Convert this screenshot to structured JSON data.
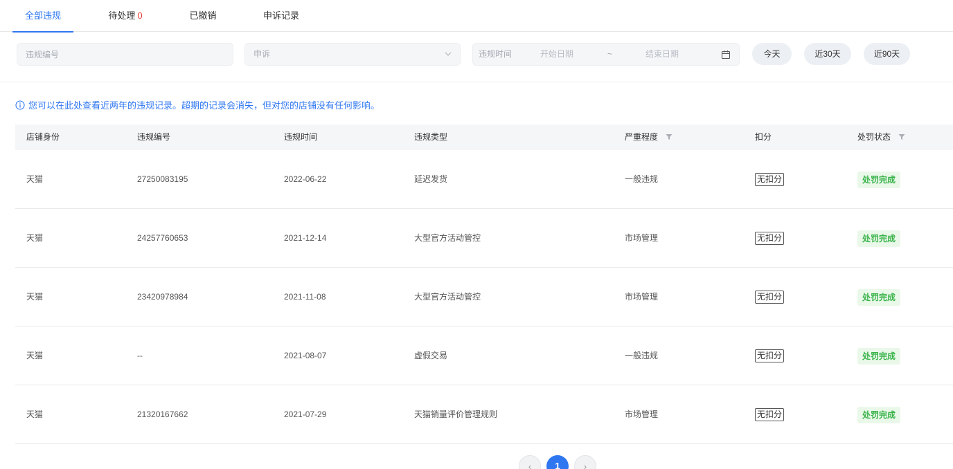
{
  "tabs": [
    {
      "label": "全部违规"
    },
    {
      "label": "待处理",
      "count": "0"
    },
    {
      "label": "已撤销"
    },
    {
      "label": "申诉记录"
    }
  ],
  "filters": {
    "violation_no_placeholder": "违规编号",
    "appeal_select_value": "申诉",
    "date_label": "违规时间",
    "start_placeholder": "开始日期",
    "separator": "~",
    "end_placeholder": "结束日期",
    "quick_buttons": [
      "今天",
      "近30天",
      "近90天"
    ]
  },
  "notice": "您可以在此处查看近两年的违规记录。超期的记录会消失，但对您的店铺没有任何影响。",
  "table": {
    "headers": [
      "店铺身份",
      "违规编号",
      "违规时间",
      "违规类型",
      "严重程度",
      "扣分",
      "处罚状态"
    ],
    "rows": [
      {
        "shop": "天猫",
        "no": "27250083195",
        "date": "2022-06-22",
        "type": "延迟发货",
        "severity": "一般违规",
        "points": "无扣分",
        "status": "处罚完成"
      },
      {
        "shop": "天猫",
        "no": "24257760653",
        "date": "2021-12-14",
        "type": "大型官方活动管控",
        "severity": "市场管理",
        "points": "无扣分",
        "status": "处罚完成"
      },
      {
        "shop": "天猫",
        "no": "23420978984",
        "date": "2021-11-08",
        "type": "大型官方活动管控",
        "severity": "市场管理",
        "points": "无扣分",
        "status": "处罚完成"
      },
      {
        "shop": "天猫",
        "no": "--",
        "date": "2021-08-07",
        "type": "虚假交易",
        "severity": "一般违规",
        "points": "无扣分",
        "status": "处罚完成"
      },
      {
        "shop": "天猫",
        "no": "21320167662",
        "date": "2021-07-29",
        "type": "天猫销量评价管理规则",
        "severity": "市场管理",
        "points": "无扣分",
        "status": "处罚完成"
      }
    ]
  },
  "pagination": {
    "prev": "‹",
    "current": "1",
    "next": "›"
  },
  "colors": {
    "accent": "#2f77f1",
    "status_green": "#39b34a",
    "pending_red": "#e53935"
  }
}
